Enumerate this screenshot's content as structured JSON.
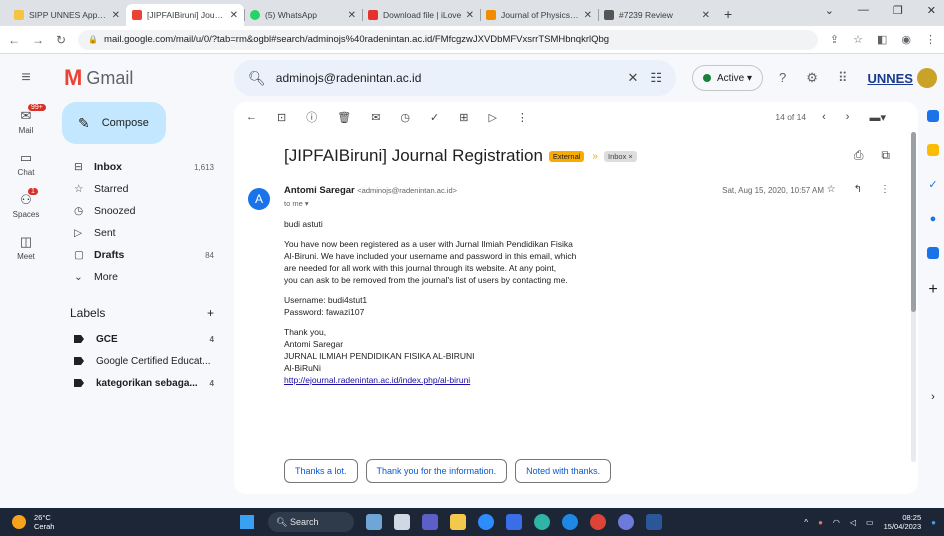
{
  "browser": {
    "tabs": [
      {
        "title": "SIPP UNNES Applicat",
        "color": "#f6c343"
      },
      {
        "title": "[JIPFAIBiruni] Journal",
        "color": "#ea4335",
        "active": true
      },
      {
        "title": "(5) WhatsApp",
        "color": "#25d366"
      },
      {
        "title": "Download file | iLove",
        "color": "#e5322d"
      },
      {
        "title": "Journal of Physics: Co",
        "color": "#f28b00"
      },
      {
        "title": "#7239 Review",
        "color": "#555"
      }
    ],
    "url": "mail.google.com/mail/u/0/?tab=rm&ogbl#search/adminojs%40radenintan.ac.id/FMfcgzwJXVDbMFVxsrrTSMHbnqkrlQbg"
  },
  "gmail": {
    "brand": "Gmail",
    "search_query": "adminojs@radenintan.ac.id",
    "status": "Active",
    "org_logo_text": "UNNES"
  },
  "rail": [
    {
      "label": "Mail",
      "icon": "mail-icon",
      "badge": "99+"
    },
    {
      "label": "Chat",
      "icon": "chat-icon"
    },
    {
      "label": "Spaces",
      "icon": "spaces-icon",
      "badge": "1"
    },
    {
      "label": "Meet",
      "icon": "meet-icon"
    }
  ],
  "sidebar": {
    "compose": "Compose",
    "items": [
      {
        "label": "Inbox",
        "count": "1,613",
        "icon": "inbox-icon",
        "bold": true
      },
      {
        "label": "Starred",
        "count": "",
        "icon": "star-icon"
      },
      {
        "label": "Snoozed",
        "count": "",
        "icon": "clock-icon"
      },
      {
        "label": "Sent",
        "count": "",
        "icon": "send-icon"
      },
      {
        "label": "Drafts",
        "count": "84",
        "icon": "draft-icon",
        "bold": true
      },
      {
        "label": "More",
        "count": "",
        "icon": "chevron-down-icon"
      }
    ],
    "labels_title": "Labels",
    "labels": [
      {
        "label": "GCE",
        "count": "4"
      },
      {
        "label": "Google Certified Educat...",
        "count": ""
      },
      {
        "label": "kategorikan sebaga...",
        "count": "4"
      }
    ]
  },
  "message": {
    "position": "14 of 14",
    "subject": "[JIPFAIBiruni] Journal Registration",
    "external": "External",
    "folder": "Inbox ×",
    "sender_name": "Antomi Saregar",
    "sender_email": "<adminojs@radenintan.ac.id>",
    "to": "to me ▾",
    "avatar_letter": "A",
    "date": "Sat, Aug 15, 2020, 10:57 AM",
    "greeting": "budi astuti",
    "para1_l1": "You have now been registered as a user with Jurnal Ilmiah Pendidikan Fisika",
    "para1_l2": "Al-Biruni. We have included your username and password in this email, which",
    "para1_l3": "are needed for all work with this journal through its website. At any point,",
    "para1_l4": "you can ask to be removed from the journal's list of users by contacting me.",
    "username": "Username: budi4stut1",
    "password": "Password: fawazi107",
    "sign1": "Thank you,",
    "sign2": "Antomi Saregar",
    "sign3": "JURNAL ILMIAH PENDIDIKAN FISIKA AL-BIRUNI",
    "sign4": "Al-BiRuNi",
    "link": "http://ejournal.radenintan.ac.id/index.php/al-biruni",
    "smart_replies": [
      "Thanks a lot.",
      "Thank you for the information.",
      "Noted with thanks."
    ]
  },
  "taskbar": {
    "temp": "26°C",
    "weather": "Cerah",
    "search": "Search",
    "time": "08:25",
    "date": "15/04/2023"
  }
}
